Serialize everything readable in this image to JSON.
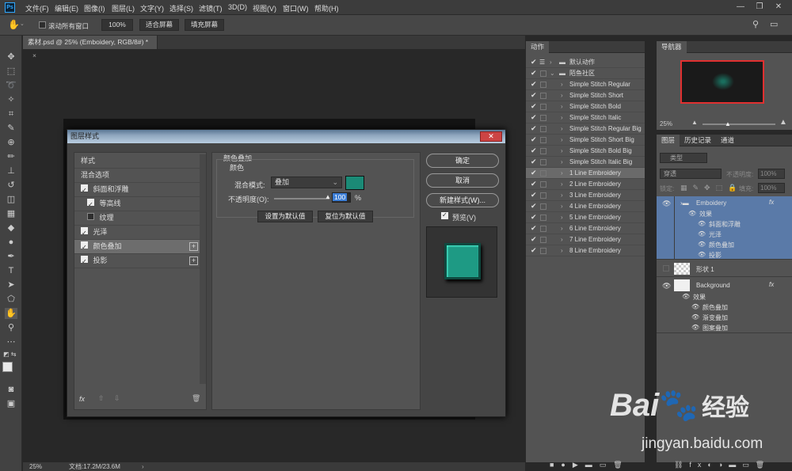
{
  "app": {
    "logo": "Ps",
    "colors": {
      "teal": "#1b8a76",
      "highlight": "#3c7ed6"
    }
  },
  "menu": [
    "文件(F)",
    "编辑(E)",
    "图像(I)",
    "图层(L)",
    "文字(Y)",
    "选择(S)",
    "滤镜(T)",
    "3D(D)",
    "视图(V)",
    "窗口(W)",
    "帮助(H)"
  ],
  "window_controls": {
    "minimize": "—",
    "maximize": "❐",
    "close": "✕"
  },
  "options": {
    "scroll_all": "滚动所有窗口",
    "zoom": "100%",
    "fit_screen": "适合屏幕",
    "fill_screen": "填充屏幕"
  },
  "document": {
    "tab": "素材.psd @ 25% (Emboidery, RGB/8#) *",
    "tab_close": "×",
    "zoom": "25%",
    "doc_info": "文档:17.2M/23.6M"
  },
  "actions": {
    "header": "动作",
    "rows": [
      {
        "label": "默认动作",
        "folder": true
      },
      {
        "label": "陌鱼社区",
        "folder": true,
        "open": true
      },
      {
        "label": "Simple Stitch Regular"
      },
      {
        "label": "Simple Stitch Short"
      },
      {
        "label": "Simple Stitch Bold"
      },
      {
        "label": "Simple Stitch Italic"
      },
      {
        "label": "Simple Stitch Regular Big"
      },
      {
        "label": "Simple Stitch Short Big"
      },
      {
        "label": "Simple Stitch Bold Big"
      },
      {
        "label": "Simple Stitch Italic Big"
      },
      {
        "label": "1 Line Embroidery",
        "selected": true
      },
      {
        "label": "2 Line Embroidery"
      },
      {
        "label": "3 Line Embroidery"
      },
      {
        "label": "4 Line Embroidery"
      },
      {
        "label": "5 Line Embroidery"
      },
      {
        "label": "6 Line Embroidery"
      },
      {
        "label": "7 Line Embroidery"
      },
      {
        "label": "8 Line Embroidery"
      }
    ]
  },
  "navigator": {
    "header": "导航器",
    "zoom": "25%"
  },
  "layers": {
    "tabs": [
      "图层",
      "历史记录",
      "通道"
    ],
    "filter": "类型",
    "blend": "穿透",
    "opacity_label": "不透明度:",
    "opacity": "100%",
    "lock_label": "锁定:",
    "fill_label": "填充:",
    "fill": "100%",
    "rows": {
      "emboidery": {
        "name": "Emboidery",
        "fx": "fx",
        "effects": "效果",
        "e1": "斜面和浮雕",
        "e2": "光泽",
        "e3": "颜色叠加",
        "e4": "投影"
      },
      "shape": {
        "name": "形状 1"
      },
      "background": {
        "name": "Background",
        "fx": "fx",
        "effects": "效果",
        "e1": "颜色叠加",
        "e2": "渐变叠加",
        "e3": "图案叠加"
      }
    }
  },
  "dialog": {
    "title": "图层样式",
    "styles": [
      {
        "label": "样式"
      },
      {
        "label": "混合选项"
      },
      {
        "label": "斜面和浮雕",
        "checked": true
      },
      {
        "label": "等高线",
        "checked": true,
        "indent": true
      },
      {
        "label": "纹理",
        "checked": false,
        "indent": true
      },
      {
        "label": "光泽",
        "checked": true
      },
      {
        "label": "颜色叠加",
        "checked": true,
        "selected": true,
        "plus": true
      },
      {
        "label": "投影",
        "checked": true,
        "plus": true
      }
    ],
    "section_title": "颜色叠加",
    "group_title": "颜色",
    "blend_label": "混合模式:",
    "blend_value": "叠加",
    "opacity_label": "不透明度(O):",
    "opacity_value": "100",
    "percent": "%",
    "set_default": "设置为默认值",
    "reset_default": "复位为默认值",
    "ok": "确定",
    "cancel": "取消",
    "new_style": "新建样式(W)...",
    "preview": "预览(V)",
    "fx": "fx",
    "close": "✕"
  },
  "watermark": {
    "brand": "Bai",
    "brand2": "经验",
    "url": "jingyan.baidu.com"
  }
}
